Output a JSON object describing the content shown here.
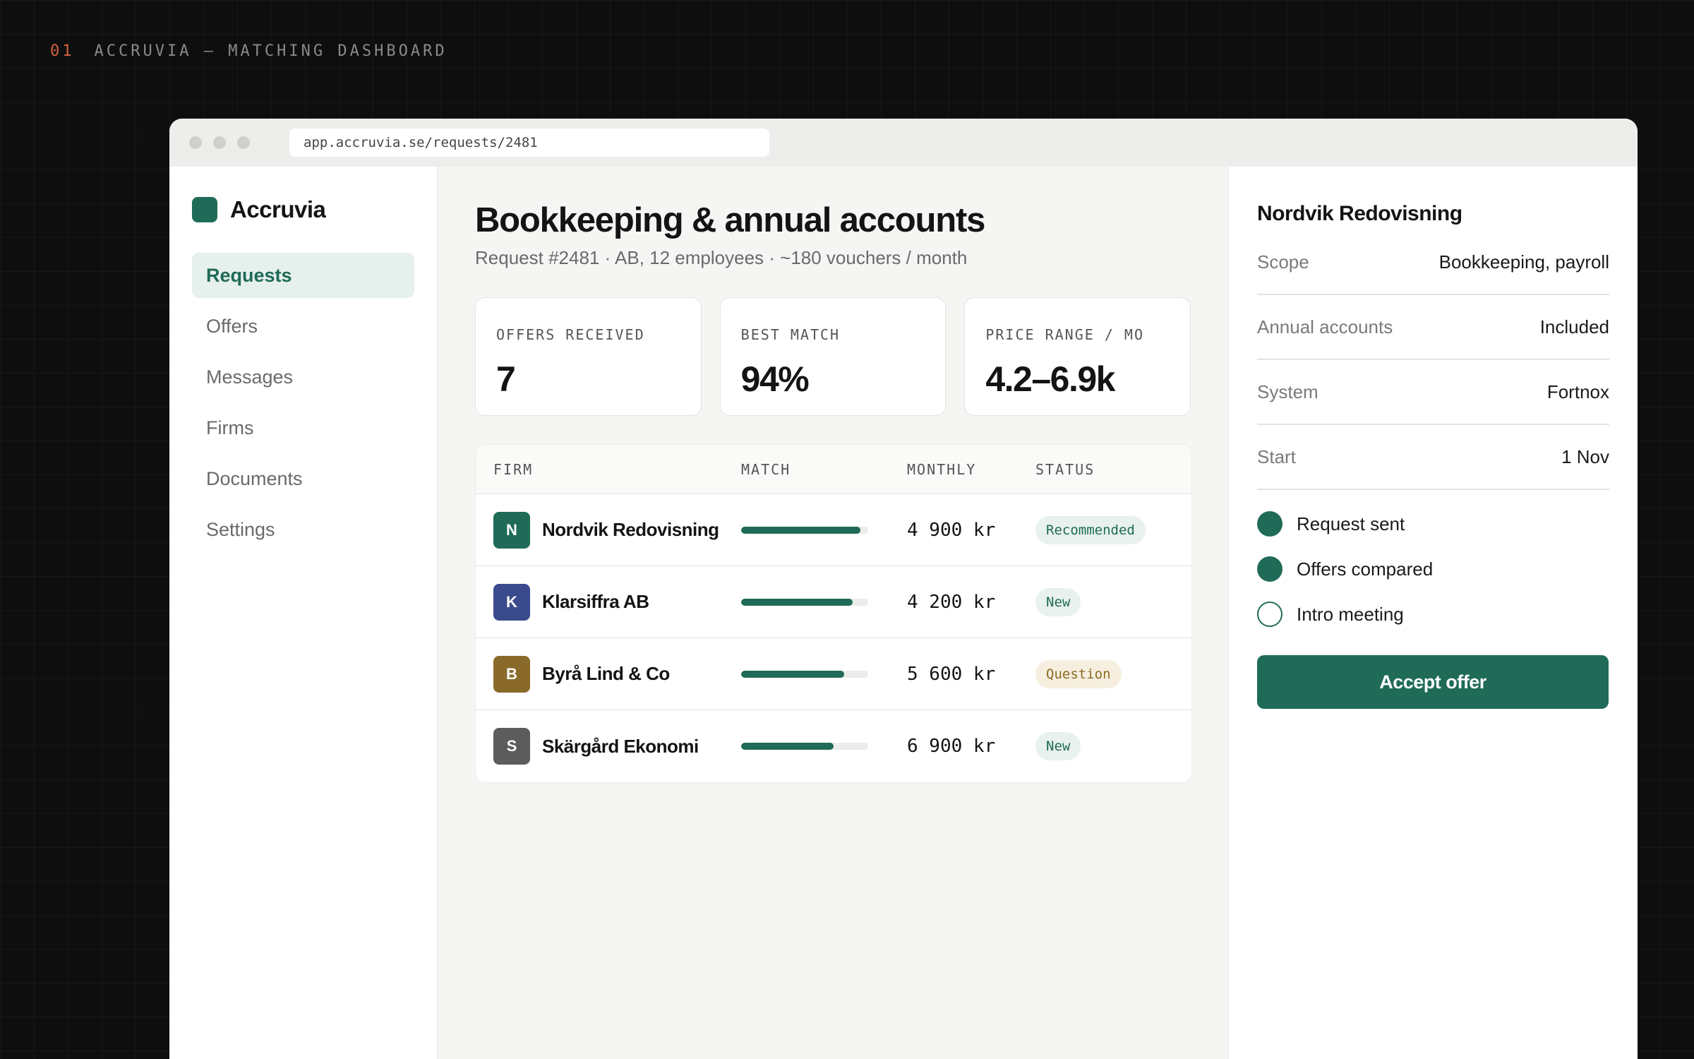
{
  "page_label": {
    "number": "01",
    "text": "ACCRUVIA — MATCHING DASHBOARD"
  },
  "browser": {
    "url": "app.accruvia.se/requests/2481"
  },
  "sidebar": {
    "brand": "Accruvia",
    "items": [
      {
        "label": "Requests",
        "active": true
      },
      {
        "label": "Offers"
      },
      {
        "label": "Messages"
      },
      {
        "label": "Firms"
      },
      {
        "label": "Documents"
      },
      {
        "label": "Settings"
      }
    ]
  },
  "main": {
    "title": "Bookkeeping & annual accounts",
    "subtitle": "Request #2481 · AB, 12 employees · ~180 vouchers / month",
    "stats": [
      {
        "label": "OFFERS RECEIVED",
        "value": "7"
      },
      {
        "label": "BEST MATCH",
        "value": "94%"
      },
      {
        "label": "PRICE RANGE / MO",
        "value": "4.2–6.9k"
      }
    ],
    "table": {
      "headers": {
        "firm": "FIRM",
        "match": "MATCH",
        "monthly": "MONTHLY",
        "status": "STATUS"
      },
      "rows": [
        {
          "initial": "N",
          "avatar_color": "#1f6b57",
          "firm": "Nordvik Redovisning",
          "match_pct": 94,
          "monthly": "4 900 kr",
          "status": "Recommended",
          "status_tone": "green"
        },
        {
          "initial": "K",
          "avatar_color": "#3b4a8c",
          "firm": "Klarsiffra AB",
          "match_pct": 88,
          "monthly": "4 200 kr",
          "status": "New",
          "status_tone": "green"
        },
        {
          "initial": "B",
          "avatar_color": "#8a6a2a",
          "firm": "Byrå Lind & Co",
          "match_pct": 81,
          "monthly": "5 600 kr",
          "status": "Question",
          "status_tone": "amber"
        },
        {
          "initial": "S",
          "avatar_color": "#5c5c5c",
          "firm": "Skärgård Ekonomi",
          "match_pct": 73,
          "monthly": "6 900 kr",
          "status": "New",
          "status_tone": "green"
        }
      ]
    }
  },
  "detail": {
    "title": "Nordvik Redovisning",
    "fields": [
      {
        "key": "Scope",
        "value": "Bookkeeping, payroll"
      },
      {
        "key": "Annual accounts",
        "value": "Included"
      },
      {
        "key": "System",
        "value": "Fortnox"
      },
      {
        "key": "Start",
        "value": "1 Nov"
      }
    ],
    "steps": [
      {
        "label": "Request sent",
        "done": true
      },
      {
        "label": "Offers compared",
        "done": true
      },
      {
        "label": "Intro meeting",
        "done": false
      }
    ],
    "accept_label": "Accept offer"
  },
  "colors": {
    "accent": "#1f6b57",
    "label_accent": "#d2623f",
    "page_background": "#0e0e0e"
  }
}
